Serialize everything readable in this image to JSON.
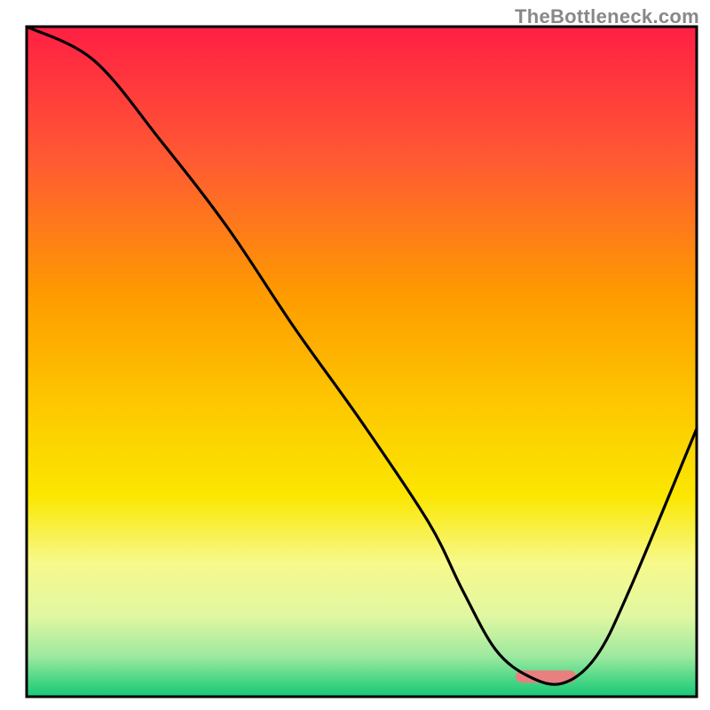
{
  "watermark": "TheBottleneck.com",
  "chart_data": {
    "type": "line",
    "title": "",
    "xlabel": "",
    "ylabel": "",
    "xlim": [
      0,
      100
    ],
    "ylim": [
      0,
      100
    ],
    "x": [
      0,
      10,
      20,
      30,
      40,
      50,
      60,
      65,
      70,
      75,
      80,
      85,
      90,
      100
    ],
    "values": [
      100,
      95,
      83,
      70,
      55,
      41,
      26,
      16,
      7,
      3,
      2,
      6,
      16,
      40
    ],
    "marker": {
      "x_start": 73,
      "x_end": 82,
      "y": 3
    },
    "background_gradient": {
      "stops": [
        {
          "offset": 0.0,
          "color": "#ff1f44"
        },
        {
          "offset": 0.2,
          "color": "#ff5a33"
        },
        {
          "offset": 0.4,
          "color": "#fe9b00"
        },
        {
          "offset": 0.55,
          "color": "#fdc400"
        },
        {
          "offset": 0.7,
          "color": "#fbe700"
        },
        {
          "offset": 0.8,
          "color": "#f7f98b"
        },
        {
          "offset": 0.88,
          "color": "#e1f7a2"
        },
        {
          "offset": 0.94,
          "color": "#9ce99f"
        },
        {
          "offset": 0.98,
          "color": "#3fd483"
        },
        {
          "offset": 1.0,
          "color": "#18c878"
        }
      ]
    },
    "marker_color": "#e88080",
    "curve_color": "#000000"
  },
  "plot": {
    "outer_width": 800,
    "outer_height": 800,
    "inner_left": 30,
    "inner_top": 30,
    "inner_width": 755,
    "inner_height": 755
  }
}
